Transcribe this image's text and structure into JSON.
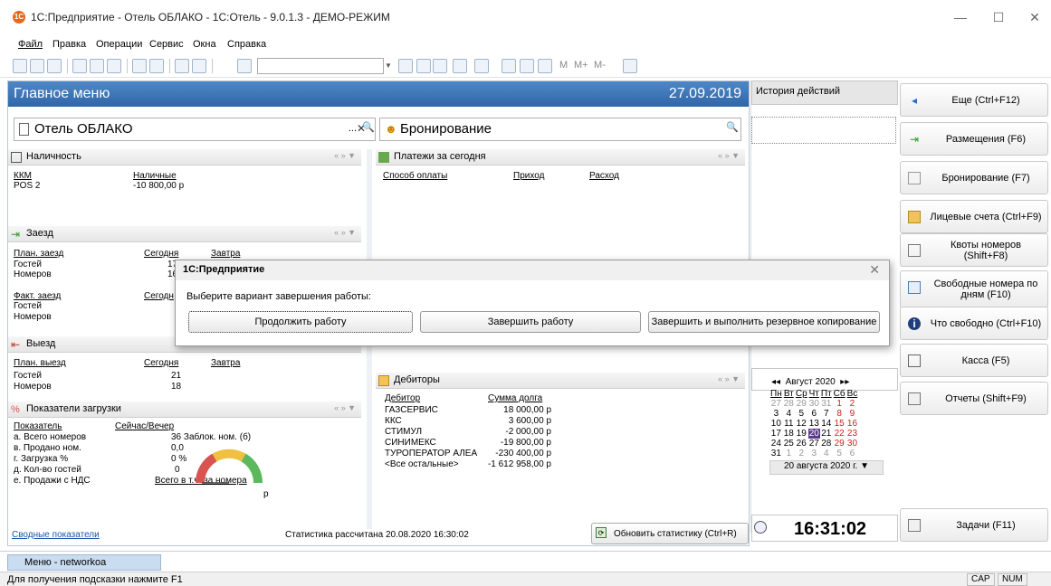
{
  "window": {
    "title": "1С:Предприятие - Отель ОБЛАКО - 1С:Отель - 9.0.1.3 - ДЕМО-РЕЖИМ",
    "logo": "1С"
  },
  "menu": [
    "Файл",
    "Правка",
    "Операции",
    "Сервис",
    "Окна",
    "Справка"
  ],
  "toolbar": {
    "m_labels": [
      "M",
      "M+",
      "M-"
    ]
  },
  "main": {
    "title": "Главное меню",
    "date": "27.09.2019",
    "hotel": "Отель ОБЛАКО",
    "booking": "Бронирование"
  },
  "availability": {
    "title": "Наличность",
    "headers": [
      "ККМ",
      "Наличные"
    ],
    "rows": [
      [
        "POS 2",
        "-10 800,00 р"
      ]
    ]
  },
  "checkin": {
    "title": "Заезд",
    "plan_label": "План. заезд",
    "today": "Сегодня",
    "tomorrow": "Завтра",
    "guests": "Гостей",
    "rooms": "Номеров",
    "plan_guests": "17",
    "plan_rooms": "16",
    "fact_label": "Факт. заезд",
    "fact_today": "Сегодн"
  },
  "checkout": {
    "title": "Выезд",
    "plan_label": "План. выезд",
    "today": "Сегодня",
    "tomorrow": "Завтра",
    "guests": "Гостей",
    "rooms": "Номеров",
    "guests_val": "21",
    "rooms_val": "18"
  },
  "load": {
    "title": "Показатели загрузки",
    "col1": "Показатель",
    "col2": "Сейчас/Вечер",
    "rows": [
      [
        "а. Всего номеров",
        "36 Заблок. ном. (б)"
      ],
      [
        "в. Продано ном.",
        "0,0"
      ],
      [
        "г. Загрузка %",
        "0 %"
      ],
      [
        "д. Кол-во гостей",
        "0"
      ],
      [
        "е. Продажи с НДС",
        "Всего в т.ч. за номера"
      ]
    ],
    "p": "р"
  },
  "payments": {
    "title": "Платежи за сегодня",
    "headers": [
      "Способ оплаты",
      "Приход",
      "Расход"
    ]
  },
  "debtors": {
    "title": "Дебиторы",
    "headers": [
      "Дебитор",
      "Сумма долга"
    ],
    "rows": [
      [
        "ГАЗСЕРВИС",
        "18 000,00 р"
      ],
      [
        "ККС",
        "3 600,00 р"
      ],
      [
        "СТИМУЛ",
        "-2 000,00 р"
      ],
      [
        "СИНИМЕКС",
        "-19 800,00 р"
      ],
      [
        "ТУРОПЕРАТОР АЛЕА",
        "-230 400,00 р"
      ],
      [
        "<Все остальные>",
        "-1 612 958,00 р"
      ]
    ]
  },
  "status": {
    "summary_link": "Сводные показатели",
    "calc": "Статистика рассчитана 20.08.2020 16:30:02",
    "refresh": "Обновить статистику (Ctrl+R)"
  },
  "history": {
    "title": "История действий"
  },
  "calendar": {
    "month": "Август 2020",
    "weekdays": [
      "Пн",
      "Вт",
      "Ср",
      "Чт",
      "Пт",
      "Сб",
      "Вс"
    ],
    "weeks": [
      [
        "27",
        "28",
        "29",
        "30",
        "31",
        "1",
        "2"
      ],
      [
        "3",
        "4",
        "5",
        "6",
        "7",
        "8",
        "9"
      ],
      [
        "10",
        "11",
        "12",
        "13",
        "14",
        "15",
        "16"
      ],
      [
        "17",
        "18",
        "19",
        "20",
        "21",
        "22",
        "23"
      ],
      [
        "24",
        "25",
        "26",
        "27",
        "28",
        "29",
        "30"
      ],
      [
        "31",
        "1",
        "2",
        "3",
        "4",
        "5",
        "6"
      ]
    ],
    "selected": "20 августа 2020 г.",
    "time": "16:31:02"
  },
  "rightbar": [
    {
      "label": "Еще (Ctrl+F12)",
      "icon": "arrow-left-icon"
    },
    {
      "label": "Размещения (F6)",
      "icon": "checkin-icon"
    },
    {
      "label": "Бронирование (F7)",
      "icon": "booking-icon"
    },
    {
      "label": "Лицевые счета (Ctrl+F9)",
      "icon": "accounts-icon"
    },
    {
      "label": "Квоты номеров (Shift+F8)",
      "icon": "quota-icon"
    },
    {
      "label": "Свободные номера по дням (F10)",
      "icon": "free-rooms-icon"
    },
    {
      "label": "Что свободно (Ctrl+F10)",
      "icon": "info-icon"
    },
    {
      "label": "Касса (F5)",
      "icon": "cash-icon"
    },
    {
      "label": "Отчеты (Shift+F9)",
      "icon": "reports-icon"
    },
    {
      "label": "Задачи (F11)",
      "icon": "tasks-icon"
    }
  ],
  "dialog": {
    "title": "1С:Предприятие",
    "question": "Выберите вариант завершения работы:",
    "buttons": [
      "Продолжить работу",
      "Завершить работу",
      "Завершить и выполнить резервное копирование"
    ]
  },
  "taskbar": {
    "tab": "Меню - networkoa"
  },
  "statusbar": {
    "hint": "Для получения подсказки нажмите F1",
    "cap": "CAP",
    "num": "NUM"
  }
}
